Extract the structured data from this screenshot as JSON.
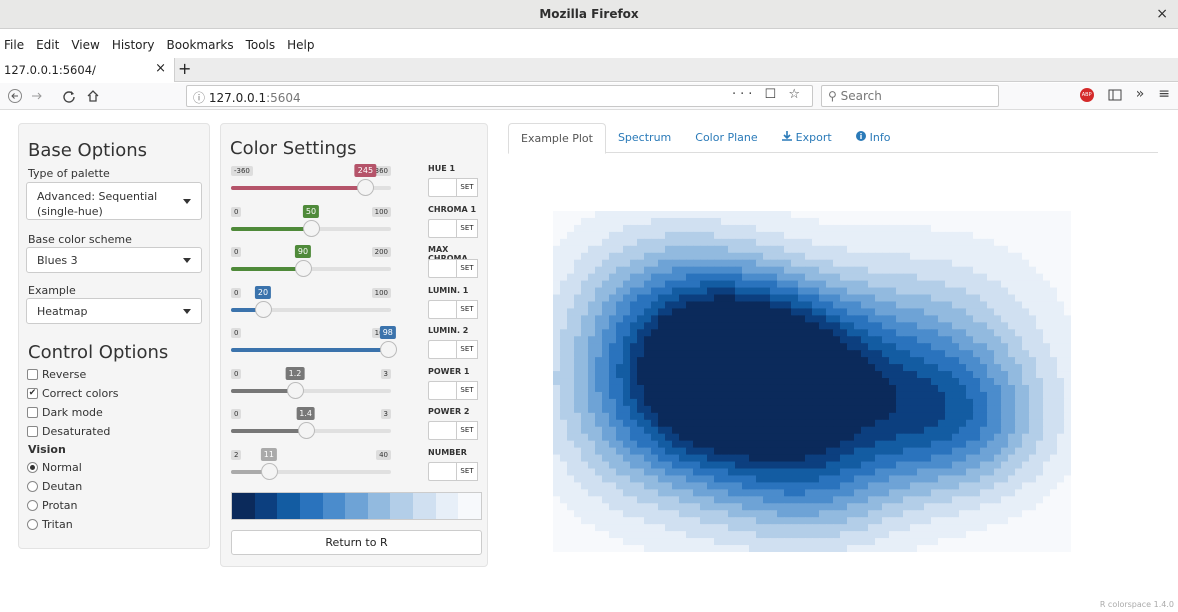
{
  "window": {
    "title": "Mozilla Firefox",
    "close_glyph": "×"
  },
  "menu": {
    "items": [
      "File",
      "Edit",
      "View",
      "History",
      "Bookmarks",
      "Tools",
      "Help"
    ]
  },
  "tabbar": {
    "tab_title": "127.0.0.1:5604/",
    "close_glyph": "×",
    "new_tab_glyph": "+"
  },
  "navbar": {
    "url_host": "127.0.0.1",
    "url_port": ":5604",
    "url_info_glyph": "ⓘ",
    "url_icons": "··· ☐ ☆",
    "search_placeholder": "Search",
    "more_glyph": "»",
    "menu_glyph": "≡"
  },
  "base": {
    "title": "Base Options",
    "palette_label": "Type of palette",
    "palette_value": "Advanced: Sequential (single-hue)",
    "scheme_label": "Base color scheme",
    "scheme_value": "Blues 3",
    "example_label": "Example",
    "example_value": "Heatmap"
  },
  "control": {
    "title": "Control Options",
    "checks": [
      {
        "label": "Reverse",
        "checked": false
      },
      {
        "label": "Correct colors",
        "checked": true
      },
      {
        "label": "Dark mode",
        "checked": false
      },
      {
        "label": "Desaturated",
        "checked": false
      }
    ],
    "vision_label": "Vision",
    "vision": [
      {
        "label": "Normal",
        "selected": true
      },
      {
        "label": "Deutan",
        "selected": false
      },
      {
        "label": "Protan",
        "selected": false
      },
      {
        "label": "Tritan",
        "selected": false
      }
    ]
  },
  "color": {
    "title": "Color Settings",
    "set_label": "SET",
    "sliders": [
      {
        "label": "HUE 1",
        "min": -360,
        "max": 360,
        "value": 245,
        "color": "#b5546a"
      },
      {
        "label": "CHROMA 1",
        "min": 0,
        "max": 100,
        "value": 50,
        "color": "#4f8a3a"
      },
      {
        "label": "MAX CHROMA",
        "min": 0,
        "max": 200,
        "value": 90,
        "color": "#4f8a3a"
      },
      {
        "label": "LUMIN. 1",
        "min": 0,
        "max": 100,
        "value": 20,
        "color": "#3b73ac"
      },
      {
        "label": "LUMIN. 2",
        "min": 0,
        "max": 100,
        "value": 98,
        "color": "#3b73ac"
      },
      {
        "label": "POWER 1",
        "min": 0,
        "max": 3,
        "value": 1.2,
        "color": "#777777"
      },
      {
        "label": "POWER 2",
        "min": 0,
        "max": 3,
        "value": 1.4,
        "color": "#777777"
      },
      {
        "label": "NUMBER",
        "min": 2,
        "max": 40,
        "value": 11,
        "color": "#aaaaaa"
      }
    ],
    "palette": [
      "#0b2a5b",
      "#0c3f7f",
      "#135ca2",
      "#2a73bd",
      "#4b8ccc",
      "#6ea3d6",
      "#92badf",
      "#b3cee8",
      "#d0e0f1",
      "#e7eff8",
      "#f7f9fc"
    ],
    "return_label": "Return to R"
  },
  "tabs": [
    {
      "label": "Example Plot",
      "active": true,
      "icon": ""
    },
    {
      "label": "Spectrum",
      "active": false,
      "icon": ""
    },
    {
      "label": "Color Plane",
      "active": false,
      "icon": ""
    },
    {
      "label": "Export",
      "active": false,
      "icon": "download-icon"
    },
    {
      "label": "Info",
      "active": false,
      "icon": "info-icon"
    }
  ],
  "footer": "R colorspace 1.4.0"
}
